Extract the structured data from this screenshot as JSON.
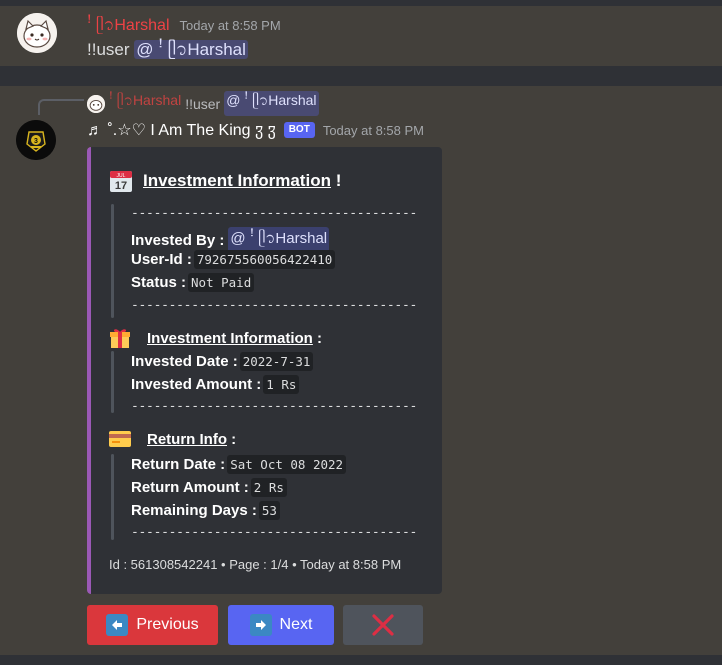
{
  "message1": {
    "username": "ꜝ ᥫ᭡Harshal",
    "timestamp": "Today at 8:58 PM",
    "text": "!!user",
    "mention": "@ ꜝ ᥫ᭡Harshal"
  },
  "reply": {
    "username": "ꜝ ᥫ᭡Harshal",
    "text": "!!user",
    "mention": "@ ꜝ ᥫ᭡Harshal"
  },
  "bot": {
    "username": "♬ ˚.☆♡ I Am The King  ჳ ჳ",
    "tag": "BOT",
    "timestamp": "Today at 8:58 PM"
  },
  "embed": {
    "accent_color": "#9b59b6",
    "title": "Investment Information",
    "title_suffix": " !",
    "title_icon": "calendar-icon",
    "divider": "--------------------------------------",
    "invested_by_label": "Invested By :",
    "invested_by_value": "@ ꜝ ᥫ᭡Harshal",
    "user_id_label": "User-Id :",
    "user_id_value": "792675560056422410",
    "status_label": "Status :",
    "status_value": "Not Paid",
    "section2_icon": "gift-icon",
    "section2_title": "Investment Information",
    "section2_suffix": " :",
    "invested_date_label": "Invested Date :",
    "invested_date_value": "2022-7-31",
    "invested_amount_label": "Invested Amount :",
    "invested_amount_value": "1 Rs",
    "section3_icon": "credit-card-icon",
    "section3_title": "Return Info",
    "section3_suffix": " :",
    "return_date_label": "Return Date :",
    "return_date_value": "Sat Oct 08 2022",
    "return_amount_label": "Return Amount :",
    "return_amount_value": "2 Rs",
    "remaining_days_label": "Remaining Days :",
    "remaining_days_value": "53",
    "footer": "Id : 561308542241 • Page : 1/4 • Today at 8:58 PM"
  },
  "buttons": {
    "previous": "Previous",
    "next": "Next",
    "close_icon": "x-icon"
  }
}
